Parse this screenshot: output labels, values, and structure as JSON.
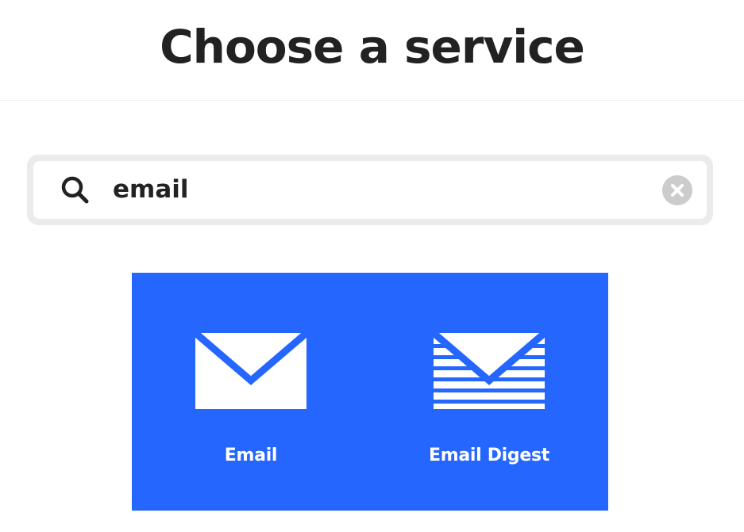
{
  "header": {
    "title": "Choose a service"
  },
  "search": {
    "value": "email",
    "placeholder": ""
  },
  "results": {
    "items": [
      {
        "label": "Email",
        "icon": "envelope-icon"
      },
      {
        "label": "Email Digest",
        "icon": "envelope-digest-icon"
      }
    ]
  },
  "colors": {
    "accent": "#2566ff",
    "text": "#222222",
    "search_border": "#ebebeb",
    "clear_icon": "#cccccc"
  }
}
